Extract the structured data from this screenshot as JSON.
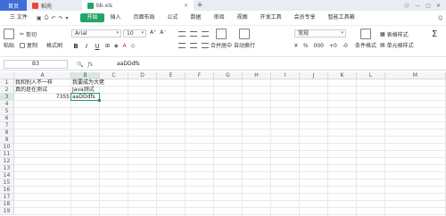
{
  "tabs": {
    "home": "首页",
    "doc": "稻壳",
    "file": "bb.xls"
  },
  "menu": {
    "file_menu": "三 文件",
    "items": [
      "开始",
      "插入",
      "页面布局",
      "公式",
      "数据",
      "审阅",
      "视图",
      "开发工具",
      "会员专享",
      "智能工具箱"
    ],
    "active_index": 0,
    "search": "Q"
  },
  "ribbon": {
    "cut": "剪切",
    "paste": "粘贴",
    "copy": "复制",
    "format_painter": "格式刷",
    "font_name": "Arial",
    "font_size": "10",
    "bold": "B",
    "italic": "I",
    "underline": "U",
    "merge_center": "合并居中",
    "wrap_text": "自动换行",
    "number_format": "常规",
    "conditional_format": "条件格式",
    "table_style": "表格样式",
    "cell_style": "单元格样式",
    "sum": "Σ"
  },
  "formula_bar": {
    "cell_ref": "B3",
    "value": "aaDDdfs",
    "fx_label": "fx"
  },
  "sheet": {
    "columns": [
      "A",
      "B",
      "C",
      "D",
      "E",
      "F",
      "G",
      "H",
      "I",
      "J",
      "K",
      "L",
      "M"
    ],
    "rows": [
      "1",
      "2",
      "3",
      "4",
      "5",
      "6",
      "7",
      "8",
      "9",
      "10",
      "11",
      "12",
      "13",
      "14",
      "15",
      "16",
      "17",
      "18",
      "19"
    ],
    "selected_column": "B",
    "selected_row": "3",
    "cells": {
      "A1": "我和别人不一样",
      "A2": "真的是在测试",
      "A3": "7355",
      "B1": "我要成为大佬",
      "B2": "Java测试",
      "B3": "aaDDdfs"
    }
  },
  "colors": {
    "accent": "#23a566",
    "selection": "#1f9b55",
    "home_tab": "#3e6fd8"
  }
}
